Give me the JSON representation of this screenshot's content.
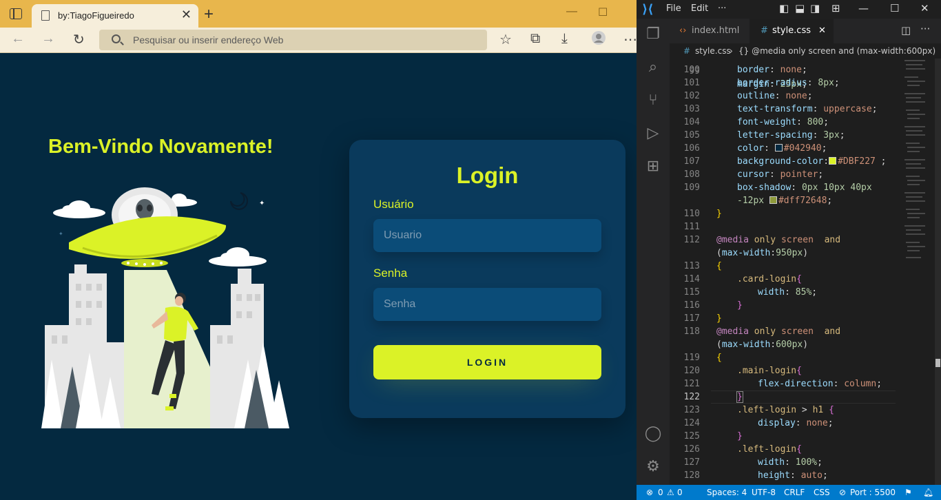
{
  "browser": {
    "tab_title": "by:TiagoFigueiredo",
    "address_placeholder": "Pesquisar ou inserir endereço Web"
  },
  "page": {
    "welcome_title": "Bem-Vindo Novamente!",
    "card_title": "Login",
    "user_label": "Usuário",
    "user_placeholder": "Usuario",
    "pass_label": "Senha",
    "pass_placeholder": "Senha",
    "button_label": "LOGIN"
  },
  "colors": {
    "page_bg": "#042940",
    "accent": "#DBF227",
    "card_bg": "#0a3a5c",
    "input_bg": "#0b4c78"
  },
  "vscode": {
    "menu": [
      "File",
      "Edit",
      "···"
    ],
    "tabs": [
      "index.html",
      "style.css"
    ],
    "breadcrumb_file": "style.css",
    "breadcrumb_rest": "{} @media only screen  and (max-width:600px)",
    "status": {
      "errors": "0",
      "warnings": "0",
      "spaces": "Spaces: 4",
      "encoding": "UTF-8",
      "eol": "CRLF",
      "language": "CSS",
      "port": "Port : 5500"
    }
  },
  "code": [
    {
      "n": "99",
      "text": "margin: 25px;"
    },
    {
      "n": "100",
      "text": "border: none;"
    },
    {
      "n": "101",
      "text": "border-radius: 8px;"
    },
    {
      "n": "102",
      "text": "outline: none;"
    },
    {
      "n": "103",
      "text": "text-transform: uppercase;"
    },
    {
      "n": "104",
      "text": "font-weight: 800;"
    },
    {
      "n": "105",
      "text": "letter-spacing: 3px;"
    },
    {
      "n": "106",
      "text": "color: #042940;"
    },
    {
      "n": "107",
      "text": "background-color: #DBF227 ;"
    },
    {
      "n": "108",
      "text": "cursor: pointer;"
    },
    {
      "n": "109",
      "text": "box-shadow: 0px 10px 40px"
    },
    {
      "n": "109b",
      "text": "-12px #dff72648;"
    },
    {
      "n": "110",
      "text": "}"
    },
    {
      "n": "111",
      "text": ""
    },
    {
      "n": "112",
      "text": "@media only screen  and"
    },
    {
      "n": "112b",
      "text": "(max-width:950px)"
    },
    {
      "n": "113",
      "text": "{"
    },
    {
      "n": "114",
      "text": ".card-login{"
    },
    {
      "n": "115",
      "text": "width: 85%;"
    },
    {
      "n": "116",
      "text": "}"
    },
    {
      "n": "117",
      "text": "}"
    },
    {
      "n": "118",
      "text": "@media only screen  and"
    },
    {
      "n": "118b",
      "text": "(max-width:600px)"
    },
    {
      "n": "119",
      "text": "{"
    },
    {
      "n": "120",
      "text": ".main-login{"
    },
    {
      "n": "121",
      "text": "flex-direction: column;"
    },
    {
      "n": "122",
      "text": "}"
    },
    {
      "n": "123",
      "text": ".left-login > h1 {"
    },
    {
      "n": "124",
      "text": "display: none;"
    },
    {
      "n": "125",
      "text": "}"
    },
    {
      "n": "126",
      "text": ".left-login{"
    },
    {
      "n": "127",
      "text": "width: 100%;"
    },
    {
      "n": "128",
      "text": "height: auto;"
    }
  ]
}
